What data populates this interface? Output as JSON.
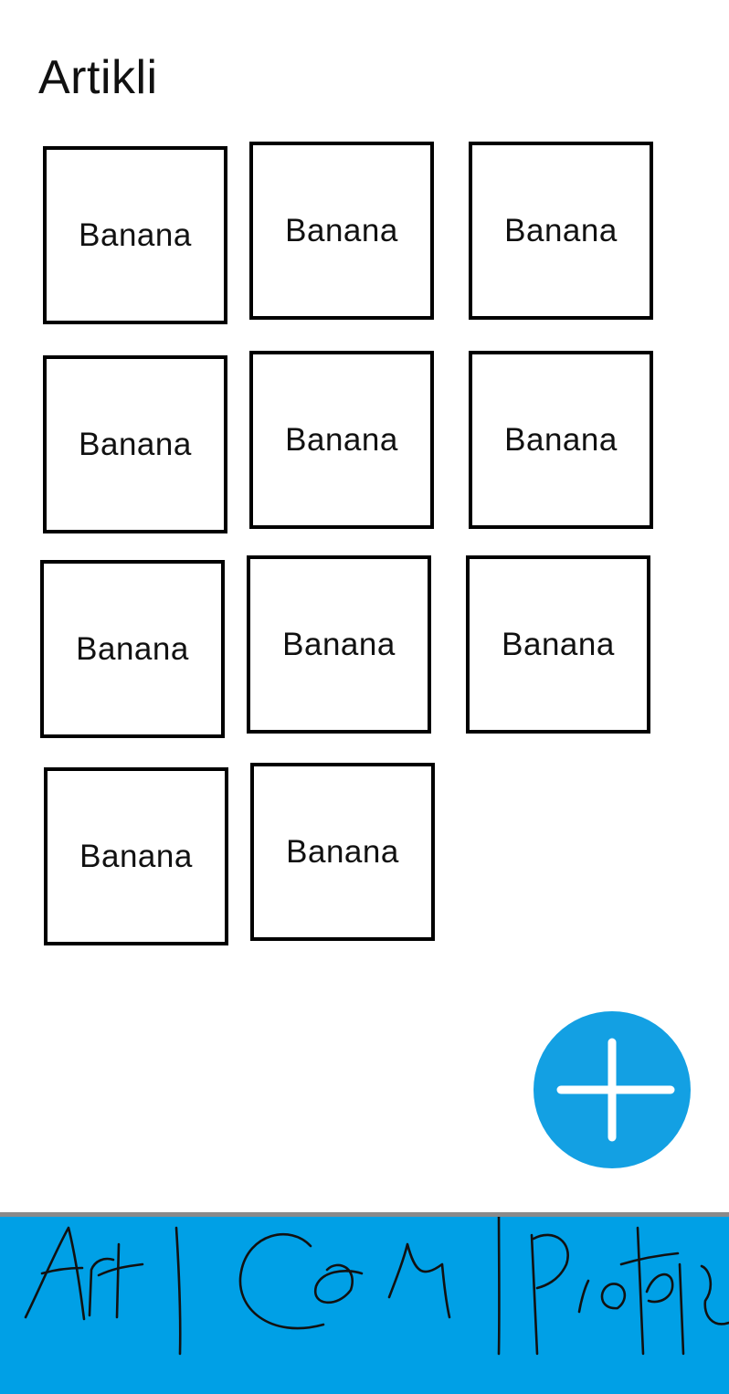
{
  "header": {
    "title": "Artikli"
  },
  "articles": [
    {
      "label": "Banana"
    },
    {
      "label": "Banana"
    },
    {
      "label": "Banana"
    },
    {
      "label": "Banana"
    },
    {
      "label": "Banana"
    },
    {
      "label": "Banana"
    },
    {
      "label": "Banana"
    },
    {
      "label": "Banana"
    },
    {
      "label": "Banana"
    },
    {
      "label": "Banana"
    },
    {
      "label": "Banana"
    }
  ],
  "fab": {
    "icon": "plus-icon",
    "color": "#13a0e3"
  },
  "bottom_nav": {
    "background": "#00a0e6",
    "items": [
      {
        "label": "Art"
      },
      {
        "label": "Cen"
      },
      {
        "label": "ProfPe"
      }
    ]
  }
}
